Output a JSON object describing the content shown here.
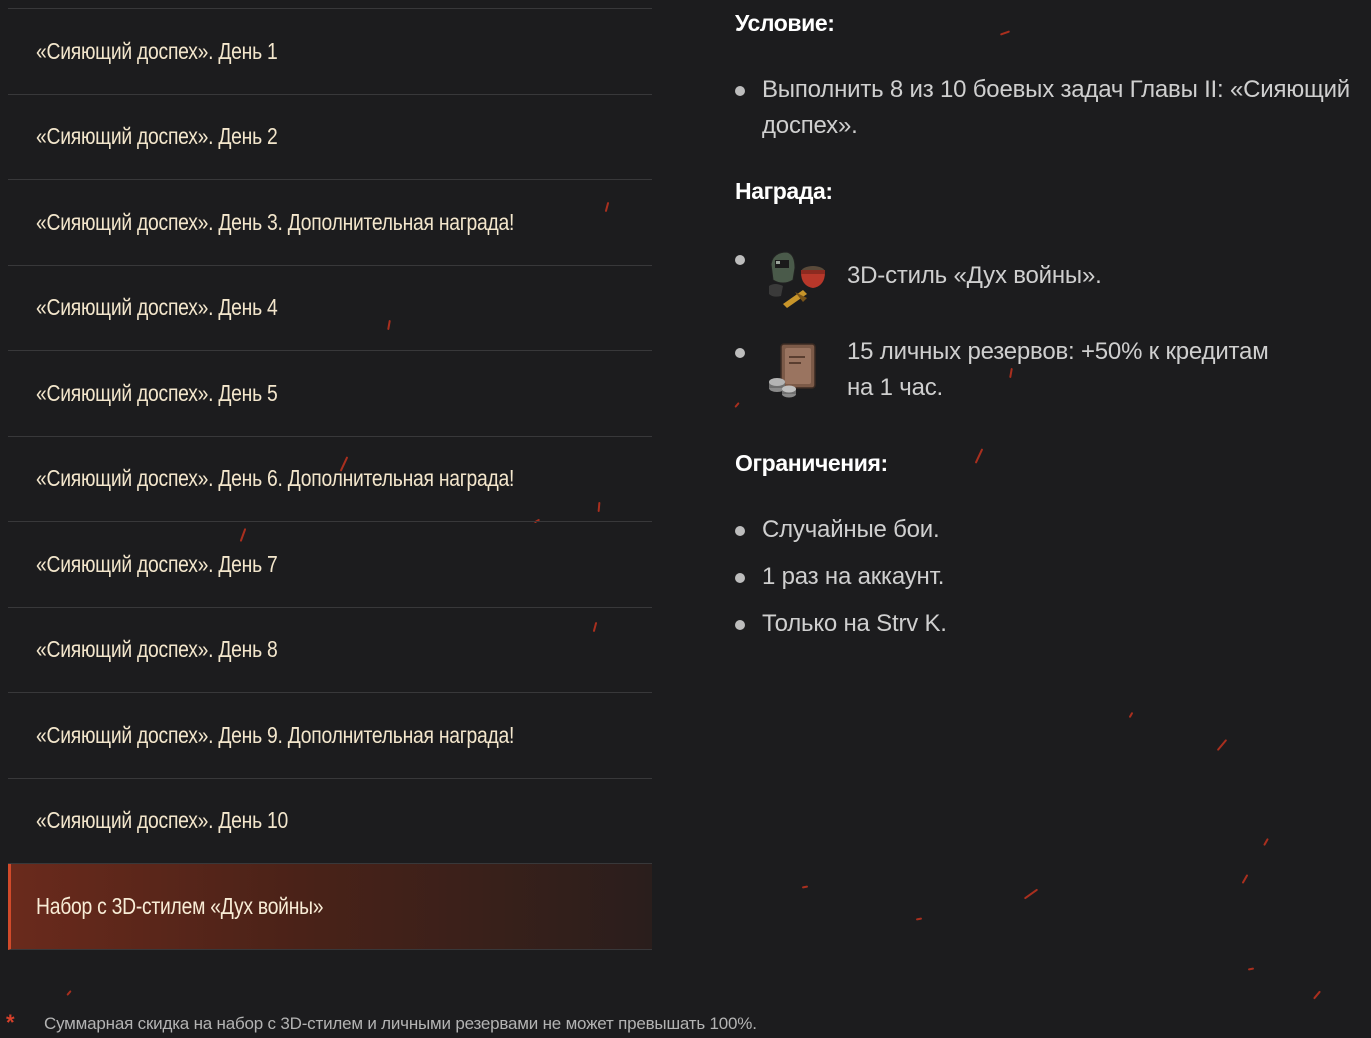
{
  "nav": {
    "items": [
      {
        "label": "«Сияющий доспех». День 1"
      },
      {
        "label": "«Сияющий доспех». День 2"
      },
      {
        "label": "«Сияющий доспех». День 3. Дополнительная награда!"
      },
      {
        "label": "«Сияющий доспех». День 4"
      },
      {
        "label": "«Сияющий доспех». День 5"
      },
      {
        "label": "«Сияющий доспех». День 6. Дополнительная награда!"
      },
      {
        "label": "«Сияющий доспех». День 7"
      },
      {
        "label": "«Сияющий доспех». День 8"
      },
      {
        "label": "«Сияющий доспех». День 9. Дополнительная награда!"
      },
      {
        "label": "«Сияющий доспех». День 10"
      },
      {
        "label": "Набор с 3D-стилем «Дух войны»",
        "active": true
      }
    ]
  },
  "detail": {
    "condition": {
      "heading": "Условие:",
      "items": [
        "Выполнить 8 из 10 боевых задач Главы II: «Сияющий доспех»."
      ]
    },
    "reward": {
      "heading": "Награда:",
      "items": [
        {
          "icon": "3d-style-icon",
          "text": "3D-стиль «Дух войны»."
        },
        {
          "icon": "personal-reserve-icon",
          "text_line1": "15 личных резервов: +50% к кредитам",
          "text_line2": "на 1 час."
        }
      ]
    },
    "limits": {
      "heading": "Ограничения:",
      "items": [
        "Случайные бои.",
        "1 раз на аккаунт.",
        "Только на Strv K."
      ]
    }
  },
  "footnote": {
    "star": "*",
    "text": "Суммарная скидка на набор с 3D-стилем и личными резервами не может превышать 100%."
  },
  "colors": {
    "background": "#1c1c1e",
    "nav_text": "#f3e6cc",
    "active_accent": "#d14a2a",
    "spark": "#c2321f"
  }
}
